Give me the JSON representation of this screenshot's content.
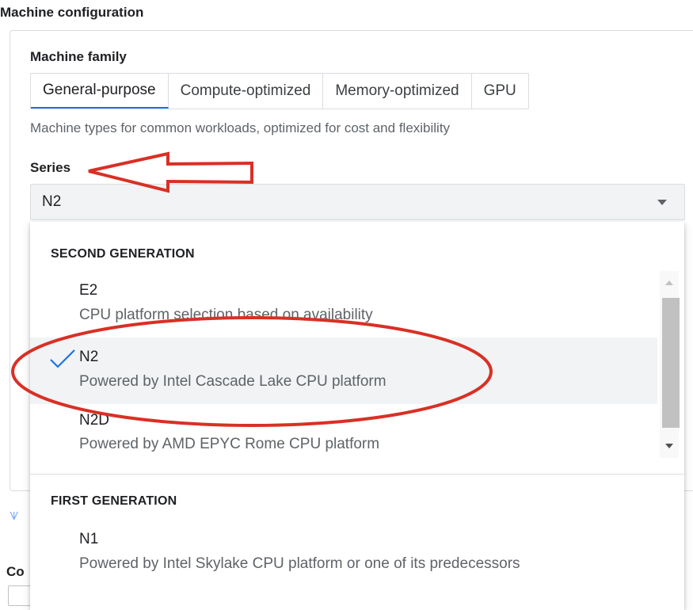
{
  "section_title": "Machine configuration",
  "machine_family": {
    "label": "Machine family",
    "tabs": [
      {
        "label": "General-purpose",
        "active": true
      },
      {
        "label": "Compute-optimized",
        "active": false
      },
      {
        "label": "Memory-optimized",
        "active": false
      },
      {
        "label": "GPU",
        "active": false
      }
    ],
    "description": "Machine types for common workloads, optimized for cost and flexibility"
  },
  "series": {
    "label": "Series",
    "selected_value": "N2"
  },
  "dropdown": {
    "groups": [
      {
        "header": "SECOND GENERATION",
        "options": [
          {
            "name": "E2",
            "description": "CPU platform selection based on availability",
            "selected": false
          },
          {
            "name": "N2",
            "description": "Powered by Intel Cascade Lake CPU platform",
            "selected": true
          },
          {
            "name": "N2D",
            "description": "Powered by AMD EPYC Rome CPU platform",
            "selected": false
          }
        ]
      },
      {
        "header": "FIRST GENERATION",
        "options": [
          {
            "name": "N1",
            "description": "Powered by Intel Skylake CPU platform or one of its predecessors",
            "selected": false
          }
        ]
      }
    ]
  },
  "partial_label": "Co",
  "icons": {
    "check": "check-icon",
    "expand": "double-chevron-down-icon",
    "caret": "caret-down-icon"
  },
  "colors": {
    "accent": "#1a73e8",
    "annotation": "#d93025"
  }
}
